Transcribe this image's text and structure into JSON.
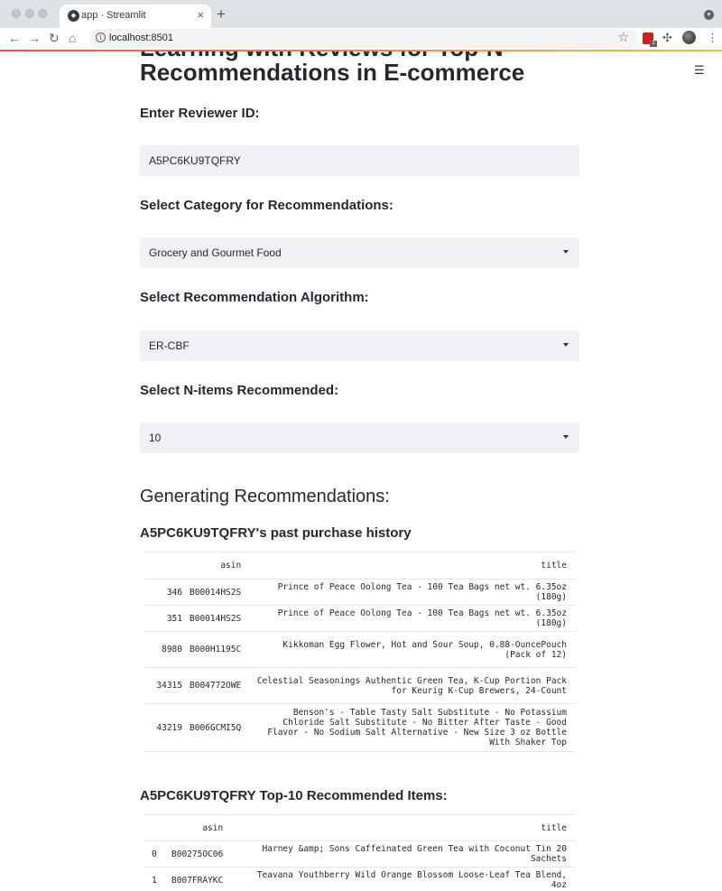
{
  "browser": {
    "tab_title": "app · Streamlit",
    "tab_close": "×",
    "new_tab": "+",
    "url": "localhost:8501",
    "nav": {
      "back": "←",
      "forward": "→",
      "reload": "↻",
      "home": "⌂"
    },
    "star": "☆",
    "extension_badge": "1",
    "puzzle_icon": "puzzle-icon",
    "menu_kebab": "⋮",
    "tab_menu": "▾",
    "accent": "#ff4b4b"
  },
  "app": {
    "title": "Learning with Reviews for Top-N Recommendations in E-commerce",
    "hamburger": "☰",
    "reviewer_label": "Enter Reviewer ID:",
    "reviewer_value": "A5PC6KU9TQFRY",
    "category_label": "Select Category for Recommendations:",
    "category_value": "Grocery and Gourmet Food",
    "algorithm_label": "Select Recommendation Algorithm:",
    "algorithm_value": "ER-CBF",
    "n_label": "Select N-items Recommended:",
    "n_value": "10",
    "generating_heading": "Generating Recommendations:",
    "history_heading": "A5PC6KU9TQFRY's past purchase history",
    "recommended_heading": "A5PC6KU9TQFRY Top-10 Recommended Items:"
  },
  "history_table": {
    "columns": [
      "",
      "asin",
      "title"
    ],
    "rows": [
      {
        "idx": "346",
        "asin": "B00014HS2S",
        "title": "Prince of Peace Oolong Tea - 100 Tea Bags net wt. 6.35oz (180g)"
      },
      {
        "idx": "351",
        "asin": "B00014HS2S",
        "title": "Prince of Peace Oolong Tea - 100 Tea Bags net wt. 6.35oz (180g)"
      },
      {
        "idx": "8980",
        "asin": "B000H1195C",
        "title": "Kikkoman Egg Flower, Hot and Sour Soup, 0.88-OuncePouch (Pack of 12)"
      },
      {
        "idx": "34315",
        "asin": "B004772OWE",
        "title": "Celestial Seasonings Authentic Green Tea, K-Cup Portion Pack for Keurig K-Cup Brewers, 24-Count"
      },
      {
        "idx": "43219",
        "asin": "B006GCMI5Q",
        "title": "Benson's - Table Tasty Salt Substitute - No Potassium Chloride Salt Substitute - No Bitter After Taste - Good Flavor - No Sodium Salt Alternative - New Size 3 oz Bottle With Shaker Top"
      }
    ]
  },
  "recommended_table": {
    "columns": [
      "",
      "asin",
      "title"
    ],
    "rows": [
      {
        "idx": "0",
        "asin": "B00275OC06",
        "title": "Harney &amp; Sons Caffeinated Green Tea with Coconut Tin 20 Sachets"
      },
      {
        "idx": "1",
        "asin": "B007FRAYKC",
        "title": "Teavana Youthberry Wild Orange Blossom Loose-Leaf Tea Blend, 4oz"
      }
    ]
  }
}
